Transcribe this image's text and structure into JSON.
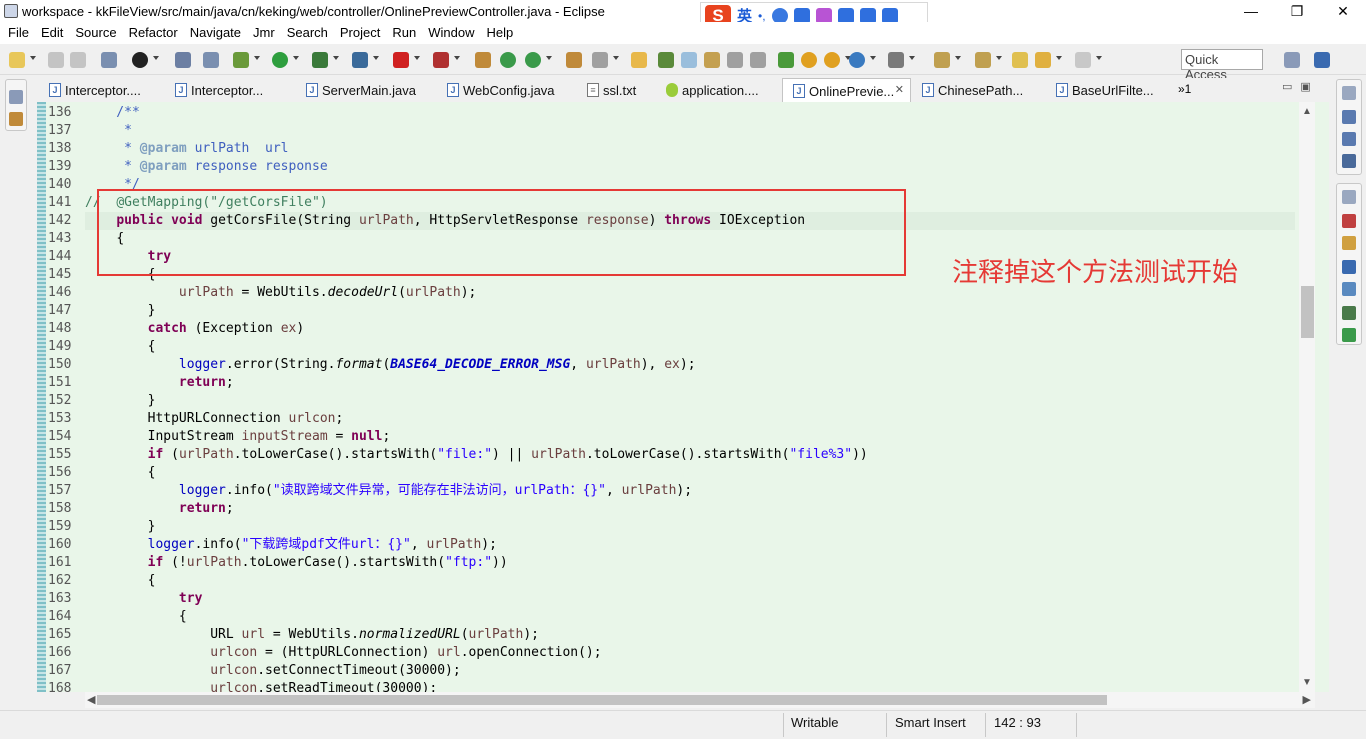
{
  "window": {
    "title": "workspace - kkFileView/src/main/java/cn/keking/web/controller/OnlinePreviewController.java - Eclipse",
    "minimize": "—",
    "restore": "❐",
    "close": "✕"
  },
  "ime": {
    "logo": "S",
    "lang": "英",
    "punct": "•,"
  },
  "menu": [
    "File",
    "Edit",
    "Source",
    "Refactor",
    "Navigate",
    "Jmr",
    "Search",
    "Project",
    "Run",
    "Window",
    "Help"
  ],
  "quick_access": {
    "placeholder": "Quick Access"
  },
  "tabs": [
    {
      "label": "Interceptor...."
    },
    {
      "label": "Interceptor..."
    },
    {
      "label": "ServerMain.java"
    },
    {
      "label": "WebConfig.java"
    },
    {
      "label": "ssl.txt"
    },
    {
      "label": "application...."
    },
    {
      "label": "OnlinePrevie...",
      "close": "✕"
    },
    {
      "label": "ChinesePath..."
    },
    {
      "label": "BaseUrlFilte..."
    }
  ],
  "tabs_overflow": "»1",
  "line_numbers": [
    "136",
    "137",
    "138",
    "139",
    "140",
    "141",
    "142",
    "143",
    "144",
    "145",
    "146",
    "147",
    "148",
    "149",
    "150",
    "151",
    "152",
    "153",
    "154",
    "155",
    "156",
    "157",
    "158",
    "159",
    "160",
    "161",
    "162",
    "163",
    "164",
    "165",
    "166",
    "167",
    "168"
  ],
  "code": {
    "l136": "    /**",
    "l137": "     *",
    "l138a": "     * ",
    "l138b": "@param",
    "l138c": " urlPath  url",
    "l139a": "     * ",
    "l139b": "@param",
    "l139c": " response response",
    "l140": "     */",
    "l141a": "//  ",
    "l141b": "@GetMapping(\"/getCorsFile\")",
    "l142_public": "public",
    "l142_void": "void",
    "l142_name": " getCorsFile(String ",
    "l142_p1": "urlPath",
    "l142_mid": ", HttpServletResponse ",
    "l142_p2": "response",
    "l142_close": ") ",
    "l142_throws": "throws",
    "l142_exc": " IOException",
    "brace_open": "{",
    "brace_close": "}",
    "try": "try",
    "catch": "catch",
    "l146_p": "urlPath",
    "l146_eq": " = WebUtils.",
    "l146_m": "decodeUrl",
    "l146_arg": "(",
    "l146_end": ");",
    "l148_rest": " (Exception ",
    "l148_ex": "ex",
    "l148_end": ")",
    "logger": "logger",
    "l150_a": ".error(String.",
    "l150_fmt": "format",
    "l150_b": "(",
    "l150_const": "BASE64_DECODE_ERROR_MSG",
    "l150_c": ", ",
    "l150_d": "), ",
    "l150_e": ");",
    "return": "return",
    "semi": ";",
    "l153_a": "HttpURLConnection ",
    "l153_v": "urlcon",
    "l154_a": "InputStream ",
    "l154_v": "inputStream",
    "l154_b": " = ",
    "null": "null",
    "if": "if",
    "l155_a": " (",
    "l155_b": ".toLowerCase().startsWith(",
    "l155_s1": "\"file:\"",
    "l155_c": ") || ",
    "l155_s2": "\"file%3\"",
    "l155_d": "))",
    "l157_a": ".info(",
    "l157_s": "\"读取跨域文件异常，可能存在非法访问，urlPath：{}\"",
    "l157_b": ", ",
    "l157_c": ");",
    "l160_s": "\"下载跨域pdf文件url：{}\"",
    "l161_a": " (!",
    "l161_b": ".toLowerCase().startsWith(",
    "l161_s": "\"ftp:\"",
    "l161_c": "))",
    "l165_a": "URL ",
    "l165_v": "url",
    "l165_b": " = WebUtils.",
    "l165_m": "normalizedURL",
    "l165_c": "(",
    "l165_d": ");",
    "l166_a": " = (HttpURLConnection) ",
    "l166_b": ".openConnection();",
    "l167_a": ".setConnectTimeout(30000);",
    "l168_a": ".setReadTimeout(30000);",
    "urlPath": "urlPath",
    "urlcon": "urlcon",
    "ex": "ex"
  },
  "annotation_note": "注释掉这个方法测试开始",
  "status": {
    "writable": "Writable",
    "insert_mode": "Smart Insert",
    "position": "142 : 93"
  },
  "colors": {
    "editor_bg": "#e9f6e9",
    "keyword": "#7f0055",
    "string": "#2a00ff",
    "javadoc": "#3f5fbf",
    "annotation_box": "#e53935"
  }
}
